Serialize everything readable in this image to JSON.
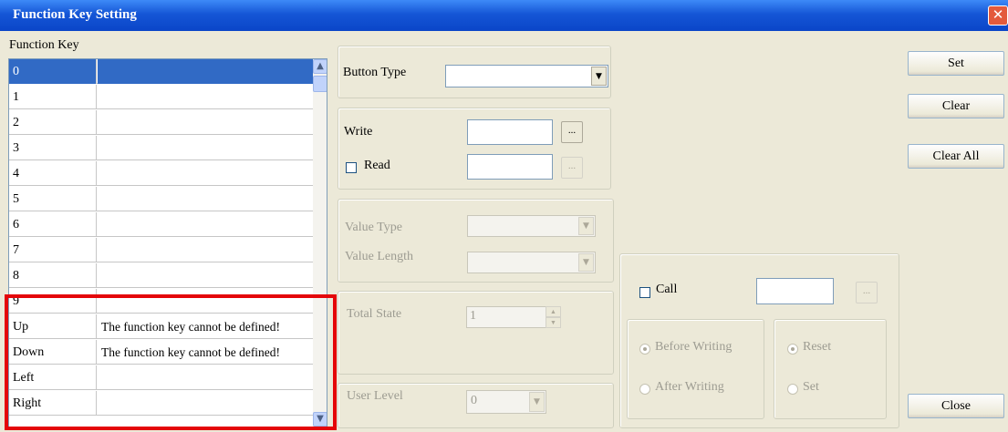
{
  "window": {
    "title": "Function Key Setting",
    "close_glyph": "✕"
  },
  "list": {
    "label": "Function Key",
    "selected_index": 0,
    "rows": [
      {
        "key": "0",
        "value": ""
      },
      {
        "key": "1",
        "value": ""
      },
      {
        "key": "2",
        "value": ""
      },
      {
        "key": "3",
        "value": ""
      },
      {
        "key": "4",
        "value": ""
      },
      {
        "key": "5",
        "value": ""
      },
      {
        "key": "6",
        "value": ""
      },
      {
        "key": "7",
        "value": ""
      },
      {
        "key": "8",
        "value": ""
      },
      {
        "key": "9",
        "value": ""
      },
      {
        "key": "Up",
        "value": "The function key cannot be defined!"
      },
      {
        "key": "Down",
        "value": "The function key cannot be defined!"
      },
      {
        "key": "Left",
        "value": ""
      },
      {
        "key": "Right",
        "value": ""
      }
    ]
  },
  "button_type": {
    "label": "Button Type",
    "value": ""
  },
  "write": {
    "label": "Write",
    "value": "",
    "browse": "..."
  },
  "read": {
    "label": "Read",
    "value": "",
    "browse": "...",
    "checked": false
  },
  "value_type": {
    "label": "Value Type",
    "value": ""
  },
  "value_length": {
    "label": "Value Length",
    "value": ""
  },
  "total_state": {
    "label": "Total State",
    "value": "1"
  },
  "user_level": {
    "label": "User Level",
    "value": "0"
  },
  "call": {
    "label": "Call",
    "value": "",
    "browse": "...",
    "checked": false
  },
  "timing": {
    "before": "Before Writing",
    "after": "After Writing",
    "selected": "Before Writing"
  },
  "action": {
    "reset": "Reset",
    "set": "Set",
    "selected": "Reset"
  },
  "buttons": {
    "set": "Set",
    "clear": "Clear",
    "clear_all": "Clear All",
    "close": "Close"
  },
  "colors": {
    "selection": "#316ac5",
    "highlight_box": "#e4060a",
    "titlebar": "#0a45c8"
  }
}
